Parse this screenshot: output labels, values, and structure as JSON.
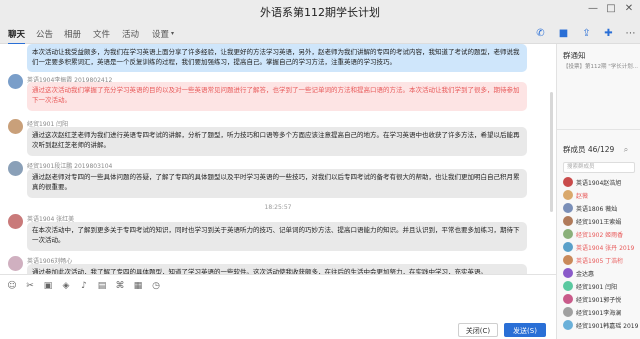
{
  "window": {
    "title": "外语系第112期学长计划",
    "controls": [
      "—",
      "□",
      "✕"
    ]
  },
  "tabs": [
    {
      "label": "聊天"
    },
    {
      "label": "公告"
    },
    {
      "label": "相册"
    },
    {
      "label": "文件"
    },
    {
      "label": "活动"
    },
    {
      "label": "设置",
      "has_dropdown": true
    }
  ],
  "messages": [
    {
      "sender": "",
      "text": "本次活动让我受益颇多，为我们在学习英语上面分享了许多经验，让我更好的方法学习英语，另外，赵老师为我们讲解的专四的考试内容，我知道了考试的题型，老师说我们一定要多积累词汇，英语是一个反复训练的过程，我们要加强练习，提高自己。掌握自己的学习方法，注重英语的学习技巧。",
      "style": "blue"
    },
    {
      "sender": "英语1904李振霞 2019802412",
      "text": "通过这次活动我们掌握了充分学习英语的目的以及对一些英语常见问题进行了解答，也学到了一些记单词的方法和提高口语的方法。本次活动让我们学到了很多，期待参加下一次活动。",
      "style": "pink"
    },
    {
      "sender": "经贸1901 闫阳",
      "text": "通过这次赵红芝老师为我们进行英语专四考试的讲解，分析了题型，听力技巧和口语等多个方面应该注意提高自己的地方。在学习英语中也收获了许多方法，希望以后能再次听到赵红芝老师的讲解。",
      "style": "gray"
    },
    {
      "sender": "经贸1901段江鹏 2019803104",
      "text": "通过赵老师对专四的一些具体问题的答疑，了解了专四的具体题型以及平时学习英语的一些技巧，对我们以后专四考试的备考有很大的帮助，也让我们更加明白自己积月累真的很重要。",
      "style": "gray"
    },
    {
      "sender": "英语1904 张红美",
      "text": "在本次活动中，了解到更多关于专四考试的知识，同时也学习到关于英语听力的技巧、记单词的巧妙方法、提高口语能力的知识。并且认识到，平常也要多加练习，期待下一次活动。",
      "style": "gray"
    },
    {
      "sender": "英语1906刘畅心",
      "text": "通过参加此次活动，我了解了专四的具体题型，知道了学习英语的一些软件。这次活动使我收获颇多，在往后的生活中会更加努力，在实践中学习，充实英语。",
      "style": "gray"
    }
  ],
  "timestamp": "18:25:57",
  "toolbar": {
    "icons": [
      "smile-icon",
      "scissors-icon",
      "image-icon",
      "gift-icon",
      "mic-icon",
      "folder-icon",
      "code-icon",
      "doc-icon",
      "clock-icon"
    ],
    "close_label": "关闭(C)",
    "send_label": "发送(S)"
  },
  "header_icons": [
    "phone-icon",
    "video-icon",
    "share-icon",
    "add-member-icon",
    "more-icon"
  ],
  "sidebar": {
    "notice_title": "群通知",
    "notice_text": "【投票】第112期 \"学长计划...",
    "members_title": "群成员 46/129",
    "search_placeholder": "搜索群成员",
    "members": [
      {
        "name": "英语1904赵浩旭",
        "color": "#333",
        "badge": "群主",
        "avatar": "#c94b4b"
      },
      {
        "name": "赵薇",
        "color": "#e85a5a",
        "avatar": "#d9a86c"
      },
      {
        "name": "英语1806 薇灿",
        "color": "#333",
        "avatar": "#7a8fb8"
      },
      {
        "name": "经贸1901王索娟",
        "color": "#333",
        "avatar": "#b07a5a"
      },
      {
        "name": "经贸1902 姬雨香",
        "color": "#e85a5a",
        "avatar": "#8ab07a"
      },
      {
        "name": "英语1904 张丹 2019",
        "color": "#e85a5a",
        "avatar": "#5aa0c9"
      },
      {
        "name": "英语1905 丁浩桁",
        "color": "#e85a5a",
        "avatar": "#c98a5a"
      },
      {
        "name": "金达惠",
        "color": "#333",
        "avatar": "#8a5ac9"
      },
      {
        "name": "经贸1901 闫阳",
        "color": "#333",
        "avatar": "#5ac9a0"
      },
      {
        "name": "经贸1901郭子悦",
        "color": "#333",
        "avatar": "#c95a8a"
      },
      {
        "name": "经贸1901李海澜",
        "color": "#333",
        "avatar": "#a0a0a0"
      },
      {
        "name": "经贸1901韩嘉瑶 2019",
        "color": "#333",
        "avatar": "#6ab0d9"
      }
    ]
  }
}
